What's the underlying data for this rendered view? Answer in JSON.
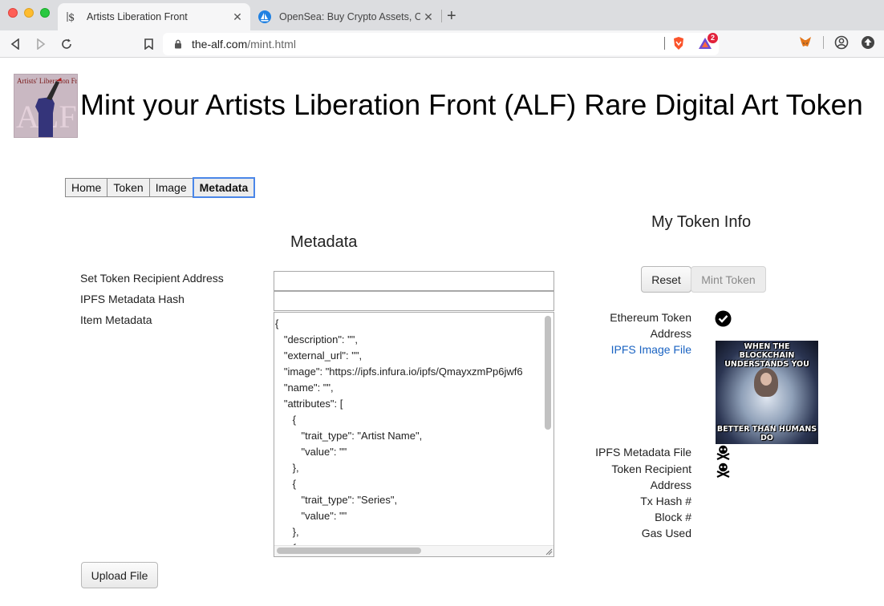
{
  "browser": {
    "tabs": [
      {
        "title": "Artists Liberation Front",
        "active": true,
        "favicon": "dollar-sign-icon"
      },
      {
        "title": "OpenSea: Buy Crypto Assets, Co",
        "active": false,
        "favicon": "opensea-sailboat-icon"
      }
    ],
    "url": {
      "host": "the-alf.com",
      "path": "/mint.html"
    },
    "rewards_badge": "2"
  },
  "page": {
    "title": "Mint your Artists Liberation Front (ALF) Rare Digital Art Token",
    "logo_text": "Artists' Liberation Front",
    "nav": [
      {
        "label": "Home",
        "active": false
      },
      {
        "label": "Token",
        "active": false
      },
      {
        "label": "Image",
        "active": false
      },
      {
        "label": "Metadata",
        "active": true
      }
    ]
  },
  "metadata_form": {
    "section_title": "Metadata",
    "recipient_label": "Set Token Recipient Address",
    "recipient_value": "",
    "ipfs_hash_label": "IPFS Metadata Hash",
    "ipfs_hash_value": "",
    "item_metadata_label": "Item Metadata",
    "item_metadata_value": "{\n   \"description\": \"\",\n   \"external_url\": \"\",\n   \"image\": \"https://ipfs.infura.io/ipfs/QmayxzmPp6jwf6\n   \"name\": \"\",\n   \"attributes\": [\n      {\n         \"trait_type\": \"Artist Name\",\n         \"value\": \"\"\n      },\n      {\n         \"trait_type\": \"Series\",\n         \"value\": \"\"\n      },\n      {",
    "upload_button": "Upload File"
  },
  "token_info": {
    "title": "My Token Info",
    "reset_button": "Reset",
    "mint_button": "Mint Token",
    "mint_disabled": true,
    "labels": {
      "eth_token_address": "Ethereum Token Address",
      "ipfs_image_file": "IPFS Image File",
      "ipfs_metadata_file": "IPFS Metadata File",
      "token_recipient_address": "Token Recipient Address",
      "tx_hash": "Tx Hash #",
      "block": "Block #",
      "gas_used": "Gas Used"
    },
    "status": {
      "eth_token_address": "check-circle-icon",
      "ipfs_metadata_file": "skull-crossbones-icon",
      "token_recipient_address": "skull-crossbones-icon"
    },
    "image_caption_top": "WHEN THE BLOCKCHAIN UNDERSTANDS YOU",
    "image_caption_bottom": "BETTER THAN HUMANS DO"
  }
}
